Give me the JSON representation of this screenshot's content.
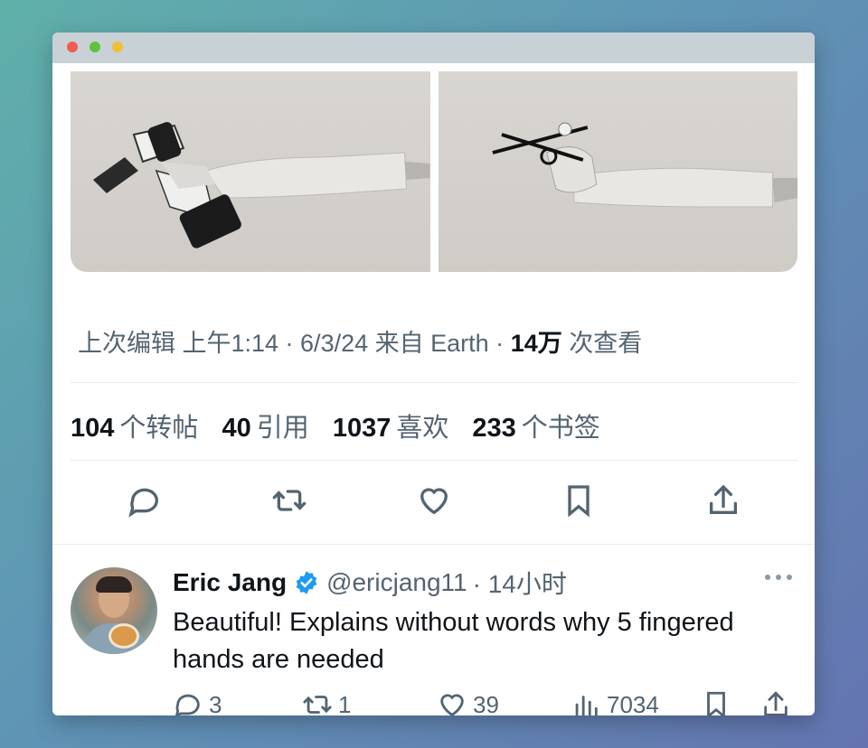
{
  "window": {
    "controls": [
      "close",
      "minimize",
      "maximize"
    ]
  },
  "tweet": {
    "meta": {
      "edited_prefix": "上次编辑 上午1:14 · 6/3/24",
      "from": "来自 Earth ·",
      "views_count": "14万",
      "views_label": "次查看"
    },
    "stats": {
      "retweets_count": "104",
      "retweets_label": "个转帖",
      "quotes_count": "40",
      "quotes_label": "引用",
      "likes_count": "1037",
      "likes_label": "喜欢",
      "bookmarks_count": "233",
      "bookmarks_label": "个书签"
    },
    "actions": [
      "reply-icon",
      "retweet-icon",
      "like-icon",
      "bookmark-icon",
      "share-icon"
    ]
  },
  "reply": {
    "name": "Eric Jang",
    "handle": "@ericjang11",
    "time": "· 14小时",
    "text": "Beautiful! Explains without words why 5 fingered hands are needed",
    "actions": {
      "replies": "3",
      "retweets": "1",
      "likes": "39",
      "views": "7034"
    }
  },
  "colors": {
    "accent": "#1d9bf0",
    "text_primary": "#0f1419",
    "text_secondary": "#536471",
    "divider": "#e6ecf0"
  }
}
